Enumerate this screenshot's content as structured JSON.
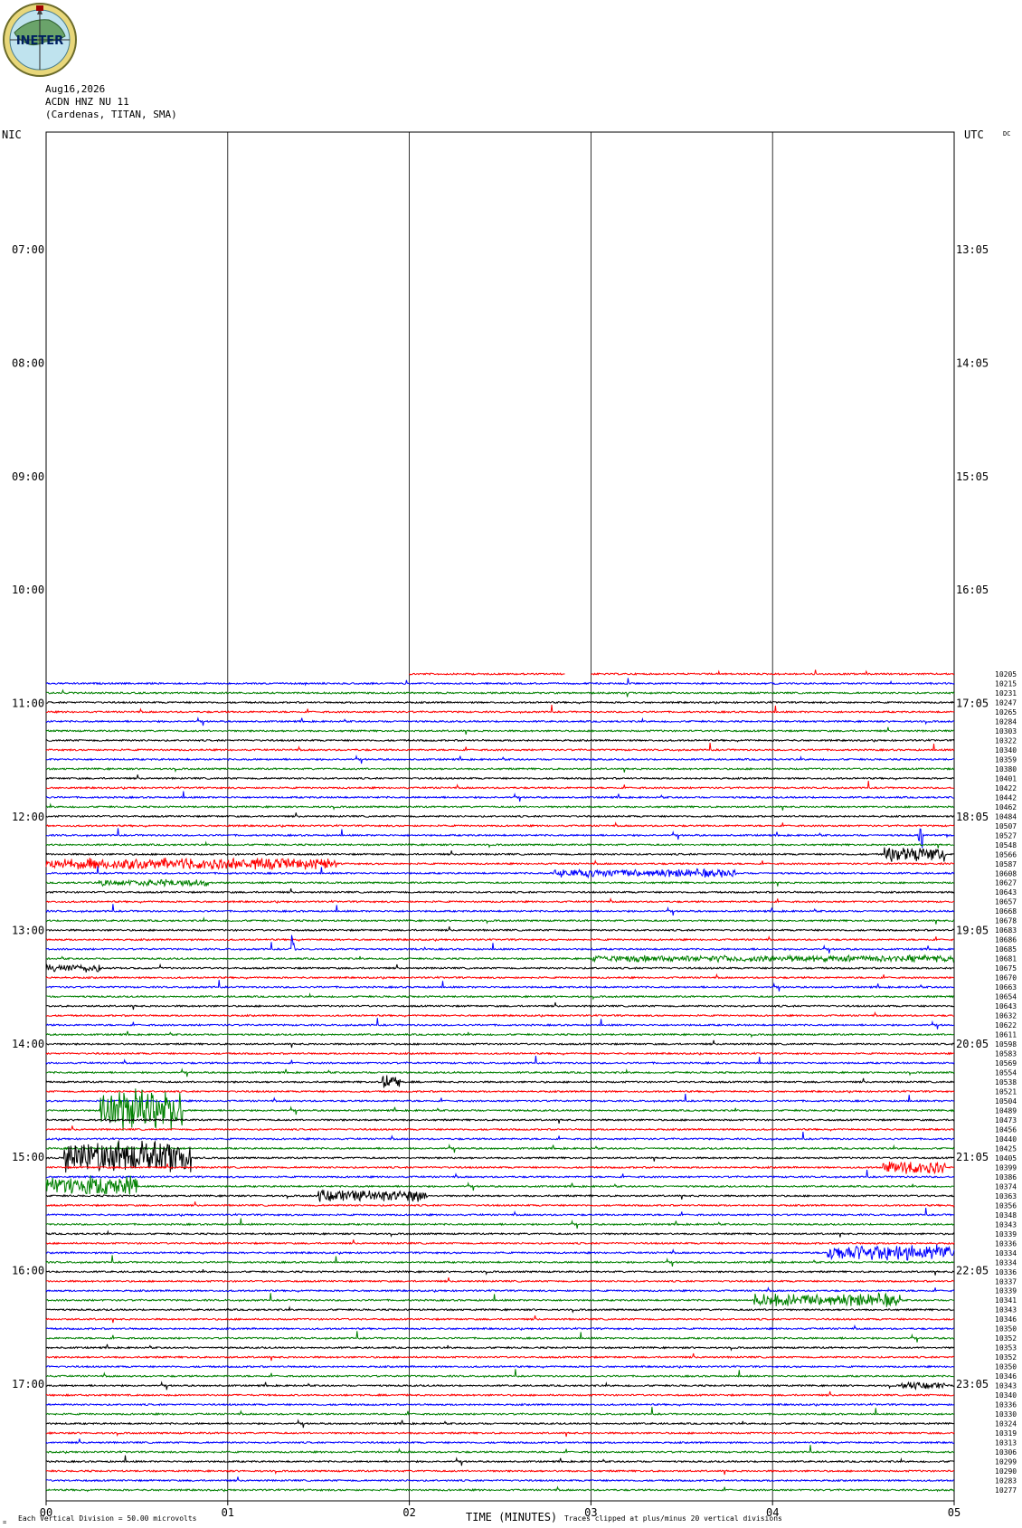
{
  "logo": {
    "text": "INETER",
    "icon": "ineter-globe-logo"
  },
  "header": {
    "date": "Aug16,2026",
    "station": "ACDN HNZ NU 11",
    "location": "(Cardenas, TITAN, SMA)",
    "left_zone": "NIC",
    "right_zone": "UTC",
    "corner_mark": "DC"
  },
  "footer": {
    "scale": "Each Vertical Division =    50.00 microvolts",
    "clip": "Traces clipped at plus/minus 20 vertical divisions",
    "corner": "="
  },
  "chart_data": {
    "type": "line",
    "title": "",
    "xlabel": "TIME (MINUTES)",
    "ylabel": "",
    "xlim": [
      0,
      5
    ],
    "x_ticks": [
      "00",
      "01",
      "02",
      "03",
      "04",
      "05"
    ],
    "left_time_labels": [
      "07:00",
      "08:00",
      "09:00",
      "10:00",
      "11:00",
      "12:00",
      "13:00",
      "14:00",
      "15:00",
      "16:00",
      "17:00"
    ],
    "right_time_labels": [
      "13:05",
      "14:05",
      "15:05",
      "16:05",
      "17:05",
      "18:05",
      "19:05",
      "20:05",
      "21:05",
      "22:05",
      "23:05"
    ],
    "color_cycle": [
      "#ff0000",
      "#0000ff",
      "#008000",
      "#000000"
    ],
    "first_trace_color_index": 0,
    "first_trace_starts_at_minute": 2,
    "first_trace_gap_minutes": [
      2.86,
      3.0
    ],
    "trace_rms_labels": [
      "10205",
      "10215",
      "10231",
      "10247",
      "10265",
      "10284",
      "10303",
      "10322",
      "10340",
      "10359",
      "10380",
      "10401",
      "10422",
      "10442",
      "10462",
      "10484",
      "10507",
      "10527",
      "10548",
      "10566",
      "10587",
      "10608",
      "10627",
      "10643",
      "10657",
      "10668",
      "10678",
      "10683",
      "10686",
      "10685",
      "10681",
      "10675",
      "10670",
      "10663",
      "10654",
      "10643",
      "10632",
      "10622",
      "10611",
      "10598",
      "10583",
      "10569",
      "10554",
      "10538",
      "10521",
      "10504",
      "10489",
      "10473",
      "10456",
      "10440",
      "10425",
      "10405",
      "10399",
      "10386",
      "10374",
      "10363",
      "10356",
      "10348",
      "10343",
      "10339",
      "10336",
      "10334",
      "10334",
      "10336",
      "10337",
      "10339",
      "10341",
      "10343",
      "10346",
      "10350",
      "10352",
      "10353",
      "10352",
      "10350",
      "10346",
      "10343",
      "10340",
      "10336",
      "10330",
      "10324",
      "10319",
      "10313",
      "10306",
      "10299",
      "10290",
      "10283",
      "10277"
    ],
    "events": [
      {
        "trace": 20,
        "start_min": 0.0,
        "end_min": 1.6,
        "amp": 7
      },
      {
        "trace": 19,
        "start_min": 4.6,
        "end_min": 4.95,
        "amp": 9
      },
      {
        "trace": 21,
        "start_min": 2.8,
        "end_min": 3.8,
        "amp": 5
      },
      {
        "trace": 22,
        "start_min": 0.3,
        "end_min": 0.9,
        "amp": 4
      },
      {
        "trace": 30,
        "start_min": 3.0,
        "end_min": 5.0,
        "amp": 4
      },
      {
        "trace": 31,
        "start_min": 0.0,
        "end_min": 0.3,
        "amp": 5
      },
      {
        "trace": 29,
        "start_min": 1.35,
        "end_min": 1.37,
        "amp": 18
      },
      {
        "trace": 51,
        "start_min": 0.1,
        "end_min": 0.8,
        "amp": 20
      },
      {
        "trace": 46,
        "start_min": 0.3,
        "end_min": 0.75,
        "amp": 26
      },
      {
        "trace": 54,
        "start_min": 0.0,
        "end_min": 0.5,
        "amp": 12
      },
      {
        "trace": 55,
        "start_min": 1.5,
        "end_min": 2.1,
        "amp": 7
      },
      {
        "trace": 61,
        "start_min": 4.3,
        "end_min": 5.0,
        "amp": 10
      },
      {
        "trace": 66,
        "start_min": 3.9,
        "end_min": 4.7,
        "amp": 8
      },
      {
        "trace": 43,
        "start_min": 1.85,
        "end_min": 1.95,
        "amp": 9
      },
      {
        "trace": 52,
        "start_min": 4.6,
        "end_min": 4.95,
        "amp": 8
      },
      {
        "trace": 17,
        "start_min": 4.8,
        "end_min": 4.83,
        "amp": 18
      },
      {
        "trace": 75,
        "start_min": 4.7,
        "end_min": 4.95,
        "amp": 4
      }
    ]
  }
}
